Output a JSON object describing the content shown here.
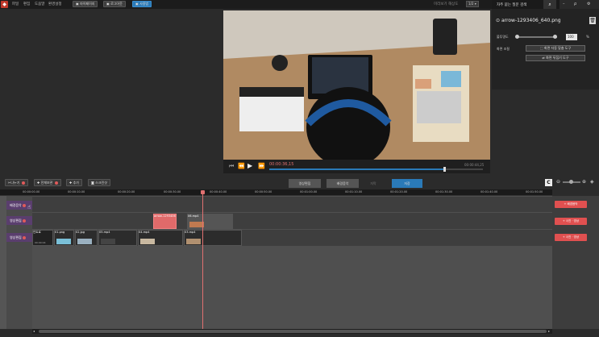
{
  "menu": {
    "file": "파일",
    "edit": "편집",
    "tools": "도움말",
    "settings": "환경설정"
  },
  "toolbar": {
    "my_page": "마이페이지",
    "logout": "로그아웃",
    "user": "사용법"
  },
  "header_right": {
    "preview_setting": "미리보기 해상도",
    "ratio": "1/2"
  },
  "help": {
    "title": "자주 묻는 질문 검색"
  },
  "properties": {
    "filename": "arrow-1293406_640.png",
    "opacity_label": "불투명도",
    "opacity_value": "100",
    "opacity_unit": "%",
    "screen_adjust_label": "화면 조절",
    "fit_button": "화면 자동 맞춤 도구",
    "flip_button": "화면 뒤집기 도구"
  },
  "player": {
    "current_time": "00:00:36,15",
    "total_time": "00:00:44,25",
    "progress": 0.82
  },
  "tools": {
    "split": "나누기",
    "select_all": "전체보관",
    "add": "추가",
    "screenshot": "스크린샷"
  },
  "tabs": {
    "video_edit": "영상편집",
    "music": "배경음악",
    "subtitle": "자막",
    "save": "저장"
  },
  "ruler_ticks": [
    "00:00:00.00",
    "00:00:10.00",
    "00:00:20.00",
    "00:00:30.00",
    "00:00:40.00",
    "00:00:50.00",
    "00:01:00.00",
    "00:01:10.00",
    "00:01:20.00",
    "00:01:30.00",
    "00:01:40.00",
    "00:01:50.00"
  ],
  "tracks": {
    "music": "배경음악",
    "overlay": "영상편집",
    "main": "영상편집"
  },
  "clips": {
    "overlay_png": "arrow-1293406",
    "overlay_mp4": "06.mp4",
    "main_intro": "인트로",
    "main_01": "01.png",
    "main_02": "02.jpg",
    "main_05": "05.mp4",
    "main_04": "04.mp4",
    "main_03": "03.mp4",
    "intro_time": "00:00:04"
  },
  "right_buttons": {
    "add_music": "+ 배경음악",
    "add_overlay": "+ 사진 · 영상",
    "add_main": "+ 사진 · 영상"
  },
  "colors": {
    "accent": "#2a7ab8",
    "record": "#e05050"
  }
}
